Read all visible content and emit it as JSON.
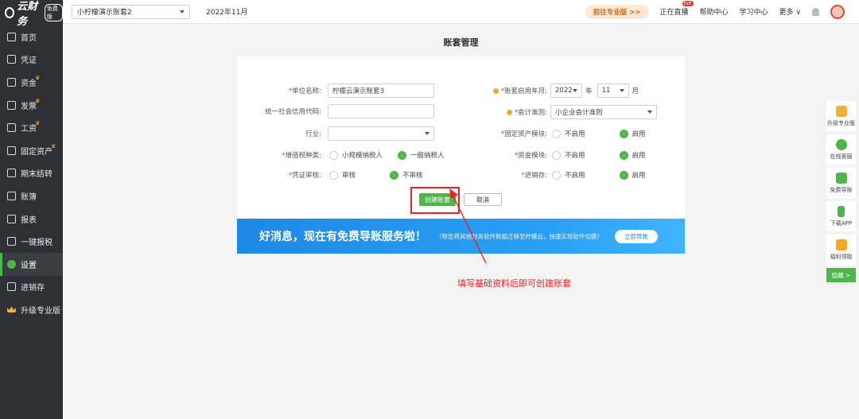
{
  "app": {
    "logo_text": "云财务",
    "logo_badge": "免费版"
  },
  "sidebar": {
    "items": [
      {
        "label": "首页",
        "icon": "home-icon"
      },
      {
        "label": "凭证",
        "icon": "voucher-icon"
      },
      {
        "label": "资金",
        "icon": "fund-icon",
        "crown": true
      },
      {
        "label": "发票",
        "icon": "invoice-icon",
        "crown": true
      },
      {
        "label": "工资",
        "icon": "salary-icon",
        "crown": true
      },
      {
        "label": "固定资产",
        "icon": "asset-icon",
        "crown": true
      },
      {
        "label": "期末结转",
        "icon": "period-end-icon"
      },
      {
        "label": "账簿",
        "icon": "ledger-icon"
      },
      {
        "label": "报表",
        "icon": "report-icon"
      },
      {
        "label": "一键报税",
        "icon": "tax-icon"
      },
      {
        "label": "设置",
        "icon": "settings-icon",
        "active": true
      },
      {
        "label": "进销存",
        "icon": "inventory-icon"
      },
      {
        "label": "升级专业版",
        "icon": "crown-icon"
      }
    ],
    "crown_glyph": "♛"
  },
  "topbar": {
    "account": "小柠檬演示账套2",
    "period": "2022年11月",
    "pro_button": "前往专业版 >>",
    "live": "正在直播",
    "live_badge": "hot",
    "help": "帮助中心",
    "learn": "学习中心",
    "more": "更多 ∨"
  },
  "page": {
    "title": "账套管理"
  },
  "form": {
    "company_name_label": "单位名称:",
    "company_name_value": "柠檬云演示账套3",
    "credit_code_label": "统一社会信用代码:",
    "credit_code_value": "",
    "industry_label": "行业:",
    "industry_value": "",
    "vat_label": "增值税种类:",
    "vat_options": [
      "小规模纳税人",
      "一般纳税人"
    ],
    "vat_selected": "一般纳税人",
    "audit_label": "凭证审核:",
    "audit_options": [
      "审核",
      "不审核"
    ],
    "audit_selected": "不审核",
    "start_period_label": "账套启用年月:",
    "start_year": "2022",
    "year_unit": "年",
    "start_month": "11",
    "month_unit": "月",
    "standard_label": "会计准则:",
    "standard_value": "小企业会计准则",
    "fixed_asset_label": "固定资产模块:",
    "fund_label": "资金模块:",
    "inventory_label": "进销存:",
    "off_label": "不启用",
    "on_label": "启用",
    "create_button": "创建账套",
    "cancel_button": "取消"
  },
  "banner": {
    "main": "好消息，现在有免费导账服务啦！",
    "sub": "（帮您将其他财务软件数据迁移至柠檬云，快速实现软件切换）",
    "button": "立即导账"
  },
  "annotation": "填写基础资料后即可创建账套",
  "floatbar": {
    "items": [
      "升级专业版",
      "在线客服",
      "免费导账",
      "下载APP",
      "福利领取"
    ],
    "hide": "隐藏 >"
  },
  "colors": {
    "accent": "#4cb648",
    "sidebar": "#2f3035",
    "annotation": "#e22222",
    "banner": "#1e88e5"
  }
}
